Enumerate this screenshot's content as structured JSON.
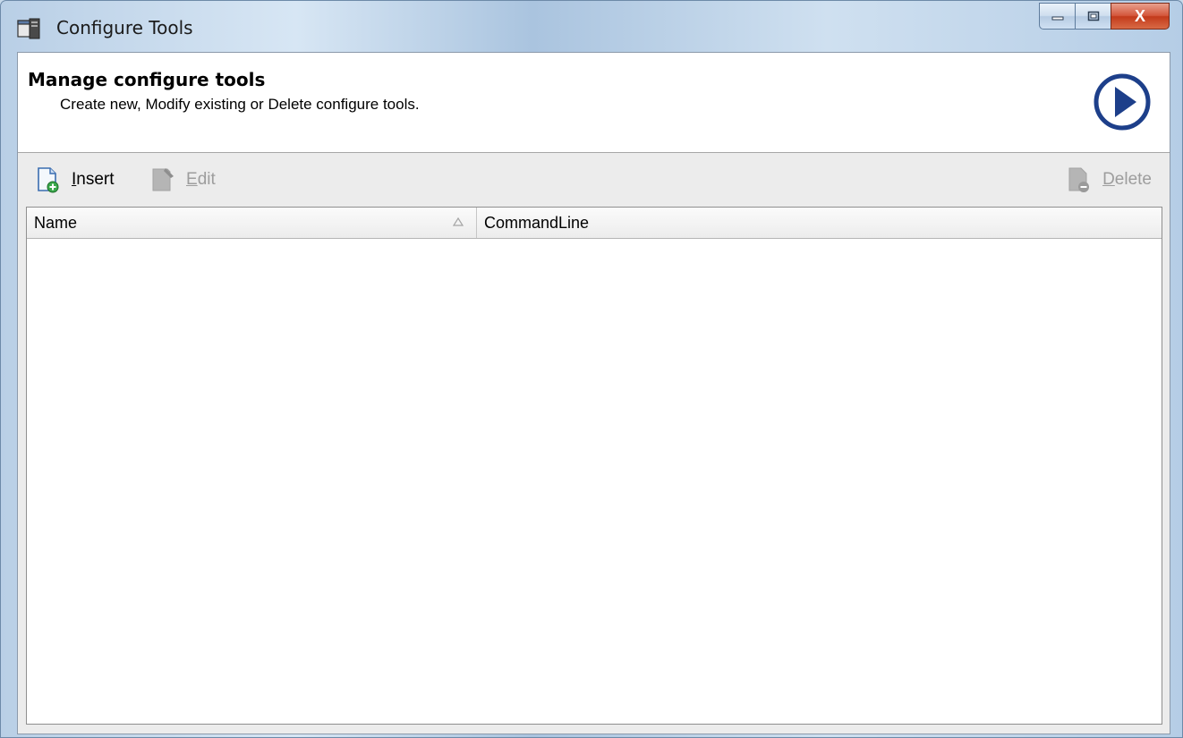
{
  "window": {
    "title": "Configure Tools",
    "caption": {
      "minimize": "—",
      "maximize": "□",
      "close": "X"
    }
  },
  "header": {
    "title": "Manage configure tools",
    "subtitle": "Create new, Modify existing or Delete configure tools."
  },
  "toolbar": {
    "insert": {
      "label": "Insert",
      "accel": "I",
      "rest": "nsert",
      "enabled": true
    },
    "edit": {
      "label": "Edit",
      "accel": "E",
      "rest": "dit",
      "enabled": false
    },
    "delete": {
      "label": "Delete",
      "accel": "D",
      "rest": "elete",
      "enabled": false
    }
  },
  "list": {
    "columns": [
      {
        "label": "Name",
        "sort": "ascending"
      },
      {
        "label": "CommandLine"
      }
    ],
    "rows": []
  },
  "colors": {
    "accent_blue": "#1d3f8a",
    "disabled_text": "#9d9d9d",
    "close_red": "#c33a1b"
  }
}
